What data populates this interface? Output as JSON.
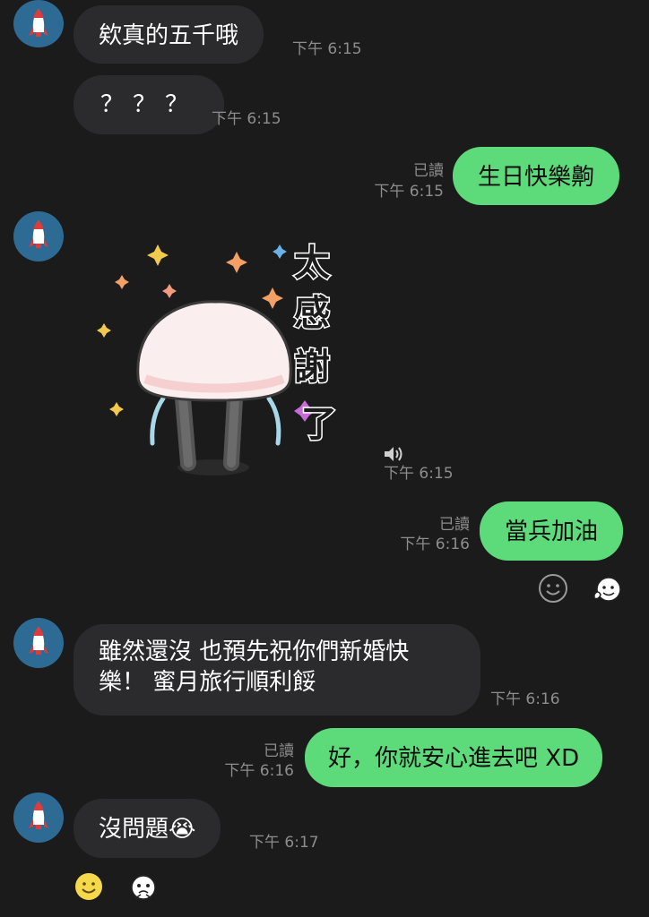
{
  "messages": [
    {
      "id": "m1",
      "direction": "in",
      "text": "欸真的五千哦",
      "time": "下午 6:15"
    },
    {
      "id": "m2",
      "direction": "in",
      "text": "？？？",
      "time": "下午 6:15"
    },
    {
      "id": "m3",
      "direction": "out",
      "text": "生日快樂齁",
      "read": "已讀",
      "time": "下午 6:15"
    },
    {
      "id": "m4",
      "direction": "in",
      "sticker_text": "太感謝了",
      "time": "下午 6:15",
      "icon": "speaker-icon"
    },
    {
      "id": "m5",
      "direction": "out",
      "text": "當兵加油",
      "read": "已讀",
      "time": "下午 6:16"
    },
    {
      "id": "m6",
      "direction": "in",
      "text": "雖然還沒 也預先祝你們新婚快樂！ 蜜月旅行順利餒",
      "time": "下午 6:16"
    },
    {
      "id": "m7",
      "direction": "out",
      "text": "好，你就安心進去吧 XD",
      "read": "已讀",
      "time": "下午 6:16"
    },
    {
      "id": "m8",
      "direction": "in",
      "text": "沒問題😭",
      "time": "下午 6:17"
    }
  ],
  "reactions": {
    "after_m5": [
      "smiley-outline-icon",
      "sticker-face-icon"
    ],
    "after_m8": [
      "smiley-yellow-icon",
      "sticker-face-icon"
    ]
  },
  "colors": {
    "background": "#1b1b1b",
    "incoming_bubble": "#2b2b2d",
    "outgoing_bubble": "#5ddb7b",
    "avatar": "#2e6b94",
    "meta_text": "#8d8d8d"
  }
}
